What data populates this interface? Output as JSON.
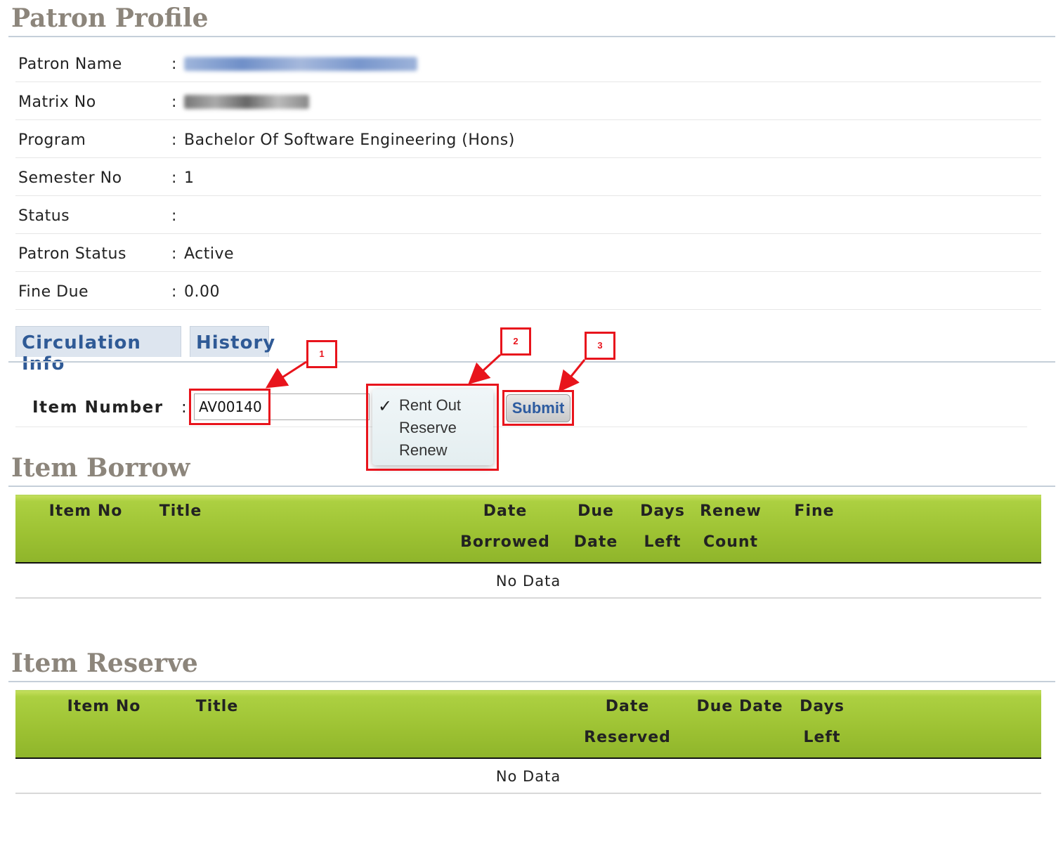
{
  "profile": {
    "title": "Patron Profile",
    "rows": [
      {
        "label": "Patron Name",
        "value": ""
      },
      {
        "label": "Matrix No",
        "value": ""
      },
      {
        "label": "Program",
        "value": "Bachelor Of Software Engineering (Hons)"
      },
      {
        "label": "Semester No",
        "value": "1"
      },
      {
        "label": "Status",
        "value": ""
      },
      {
        "label": "Patron Status",
        "value": "Active"
      },
      {
        "label": "Fine Due",
        "value": "0.00"
      }
    ],
    "separator": ":"
  },
  "tabs": [
    {
      "label": "Circulation Info"
    },
    {
      "label": "History"
    }
  ],
  "circulation": {
    "item_label": "Item Number",
    "item_value": "AV00140",
    "action_options": [
      "Rent Out",
      "Reserve",
      "Renew"
    ],
    "selected_action": "Rent Out",
    "submit_label": "Submit"
  },
  "annotations": [
    "1",
    "2",
    "3"
  ],
  "colors": {
    "annotation": "#e8141c",
    "table_header": "#a4c83a",
    "tab_text": "#2f5a96"
  },
  "borrow": {
    "title": "Item Borrow",
    "columns": [
      {
        "l1": "Item No",
        "l2": ""
      },
      {
        "l1": "Title",
        "l2": ""
      },
      {
        "l1": "Date",
        "l2": "Borrowed"
      },
      {
        "l1": "Due",
        "l2": "Date"
      },
      {
        "l1": "Days",
        "l2": "Left"
      },
      {
        "l1": "Renew",
        "l2": "Count"
      },
      {
        "l1": "Fine",
        "l2": ""
      }
    ],
    "empty": "No Data"
  },
  "reserve": {
    "title": "Item Reserve",
    "columns": [
      {
        "l1": "Item No",
        "l2": ""
      },
      {
        "l1": "Title",
        "l2": ""
      },
      {
        "l1": "Date",
        "l2": "Reserved"
      },
      {
        "l1": "Due Date",
        "l2": ""
      },
      {
        "l1": "Days",
        "l2": "Left"
      }
    ],
    "empty": "No Data"
  }
}
